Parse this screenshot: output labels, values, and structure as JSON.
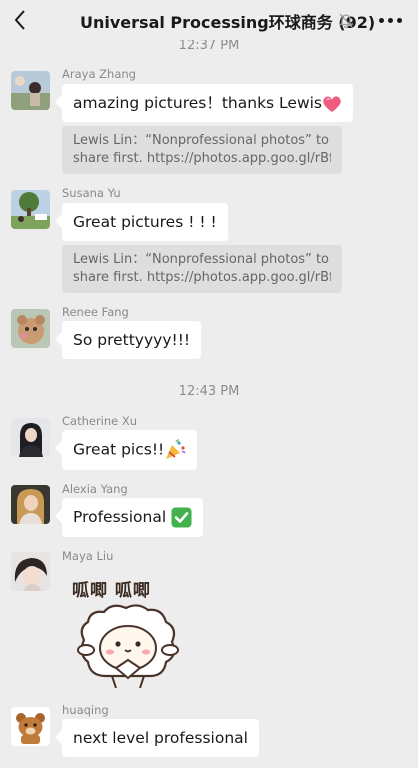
{
  "header": {
    "title": "Universal Processing环球商务 (92)"
  },
  "timestamps": [
    "12:37 PM",
    "12:43 PM"
  ],
  "messages": [
    {
      "sender": "Araya Zhang",
      "text": "amazing pictures！thanks Lewis",
      "emoji": "heart"
    },
    {
      "quote_line1": "Lewis Lin：“Nonprofessional photos” to",
      "quote_line2": "share first. https://photos.app.goo.gl/rBf..."
    },
    {
      "sender": "Susana Yu",
      "text": "Great pictures ! ! !"
    },
    {
      "quote_line1": "Lewis Lin：“Nonprofessional photos” to",
      "quote_line2": "share first. https://photos.app.goo.gl/rBf..."
    },
    {
      "sender": "Renee Fang",
      "text": "So prettyyyy!!!"
    },
    {
      "sender": "Catherine Xu",
      "text": "Great pics!!",
      "emoji": "party-popper"
    },
    {
      "sender": "Alexia Yang",
      "text": "Professional",
      "emoji": "check-mark"
    },
    {
      "sender": "Maya Liu",
      "sticker_text": "呱唧 呱唧"
    },
    {
      "sender": "huaqing",
      "text": "next level professional"
    }
  ]
}
